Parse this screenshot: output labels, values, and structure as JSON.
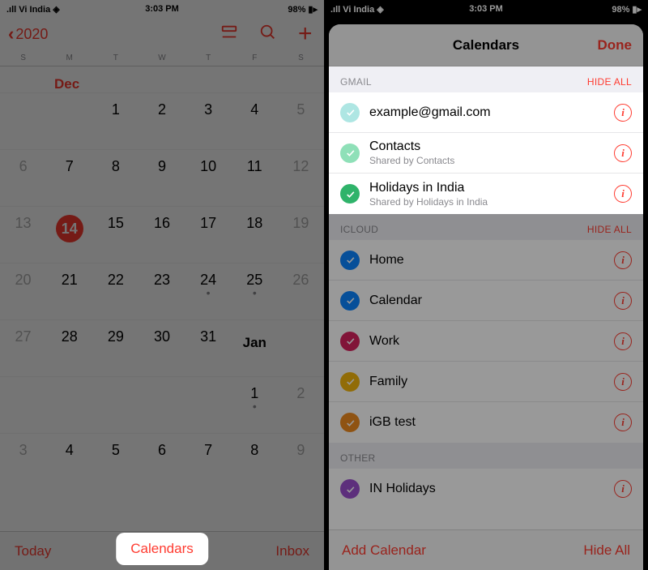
{
  "status": {
    "carrier": "Vi India",
    "time": "3:03 PM",
    "battery": "98%"
  },
  "left": {
    "back_year": "2020",
    "weekdays": [
      "S",
      "M",
      "T",
      "W",
      "T",
      "F",
      "S"
    ],
    "month": "Dec",
    "next_month": "Jan",
    "today_day": 14,
    "toolbar": {
      "today": "Today",
      "calendars": "Calendars",
      "inbox": "Inbox"
    }
  },
  "right": {
    "sheet_title": "Calendars",
    "done": "Done",
    "sections": {
      "gmail": {
        "header": "GMAIL",
        "hide": "HIDE ALL",
        "items": [
          {
            "name": "example@gmail.com",
            "sub": "",
            "color": "#aee6e3"
          },
          {
            "name": "Contacts",
            "sub": "Shared by Contacts",
            "color": "#8fe0b8"
          },
          {
            "name": "Holidays in India",
            "sub": "Shared by Holidays in India",
            "color": "#2fb36a"
          }
        ]
      },
      "icloud": {
        "header": "ICLOUD",
        "hide": "HIDE ALL",
        "items": [
          {
            "name": "Home",
            "color": "#0a84ff"
          },
          {
            "name": "Calendar",
            "color": "#0a84ff"
          },
          {
            "name": "Work",
            "color": "#d7225e"
          },
          {
            "name": "Family",
            "color": "#f2b50c"
          },
          {
            "name": "iGB test",
            "color": "#ef8b1f"
          }
        ]
      },
      "other": {
        "header": "OTHER",
        "items": [
          {
            "name": "IN Holidays",
            "color": "#9b4fcf"
          }
        ]
      }
    },
    "toolbar": {
      "add": "Add Calendar",
      "hide_all": "Hide All"
    }
  }
}
